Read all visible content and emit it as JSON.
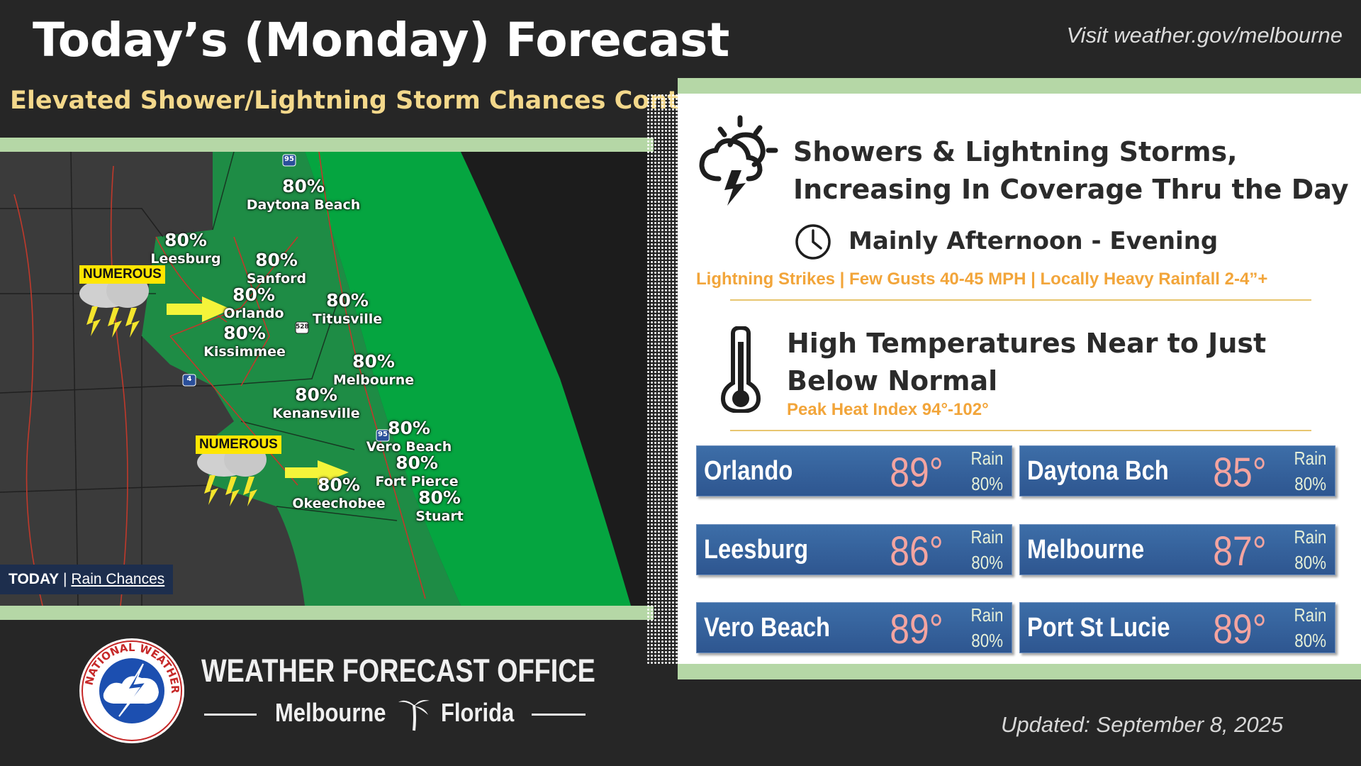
{
  "header": {
    "title": "Today’s (Monday) Forecast",
    "subtitle": "Elevated Shower/Lightning Storm Chances Continue!",
    "website": "Visit weather.gov/melbourne"
  },
  "map": {
    "legend_today": "TODAY",
    "legend_sep": "|",
    "legend_label": "Rain Chances",
    "badges": [
      "NUMEROUS",
      "NUMEROUS"
    ],
    "highway_shields": [
      "95",
      "95",
      "4",
      "528"
    ],
    "locations": [
      {
        "city": "Daytona Beach",
        "chance": "80%"
      },
      {
        "city": "Leesburg",
        "chance": "80%"
      },
      {
        "city": "Sanford",
        "chance": "80%"
      },
      {
        "city": "Orlando",
        "chance": "80%"
      },
      {
        "city": "Titusville",
        "chance": "80%"
      },
      {
        "city": "Kissimmee",
        "chance": "80%"
      },
      {
        "city": "Melbourne",
        "chance": "80%"
      },
      {
        "city": "Kenansville",
        "chance": "80%"
      },
      {
        "city": "Vero Beach",
        "chance": "80%"
      },
      {
        "city": "Fort Pierce",
        "chance": "80%"
      },
      {
        "city": "Okeechobee",
        "chance": "80%"
      },
      {
        "city": "Stuart",
        "chance": "80%"
      }
    ],
    "colors": {
      "land": "#3b3b3b",
      "rain_area": "#1e8c45",
      "coastal_water": "#05a540",
      "arrow": "#f4f43a"
    }
  },
  "panel": {
    "headline1_line1": "Showers & Lightning Storms,",
    "headline1_line2": "Increasing In Coverage Thru the Day",
    "timing": "Mainly Afternoon - Evening",
    "hazards": "Lightning Strikes | Few Gusts 40-45 MPH | Locally Heavy Rainfall 2-4”+",
    "headline2_line1": "High Temperatures Near to Just",
    "headline2_line2": "Below Normal",
    "heat_index": "Peak Heat Index 94°-102°",
    "icons": [
      "storm-cloud-icon",
      "clock-icon",
      "thermometer-icon"
    ]
  },
  "cities": [
    {
      "name": "Orlando",
      "temp": "89°",
      "rain_label": "Rain",
      "rain": "80%"
    },
    {
      "name": "Daytona Bch",
      "temp": "85°",
      "rain_label": "Rain",
      "rain": "80%"
    },
    {
      "name": "Leesburg",
      "temp": "86°",
      "rain_label": "Rain",
      "rain": "80%"
    },
    {
      "name": "Melbourne",
      "temp": "87°",
      "rain_label": "Rain",
      "rain": "80%"
    },
    {
      "name": "Vero Beach",
      "temp": "89°",
      "rain_label": "Rain",
      "rain": "80%"
    },
    {
      "name": "Port St Lucie",
      "temp": "89°",
      "rain_label": "Rain",
      "rain": "80%"
    }
  ],
  "footer": {
    "office": "WEATHER FORECAST OFFICE",
    "city": "Melbourne",
    "state": "Florida",
    "seal_text": "NATIONAL WEATHER SERVICE",
    "updated": "Updated: September 8, 2025"
  }
}
